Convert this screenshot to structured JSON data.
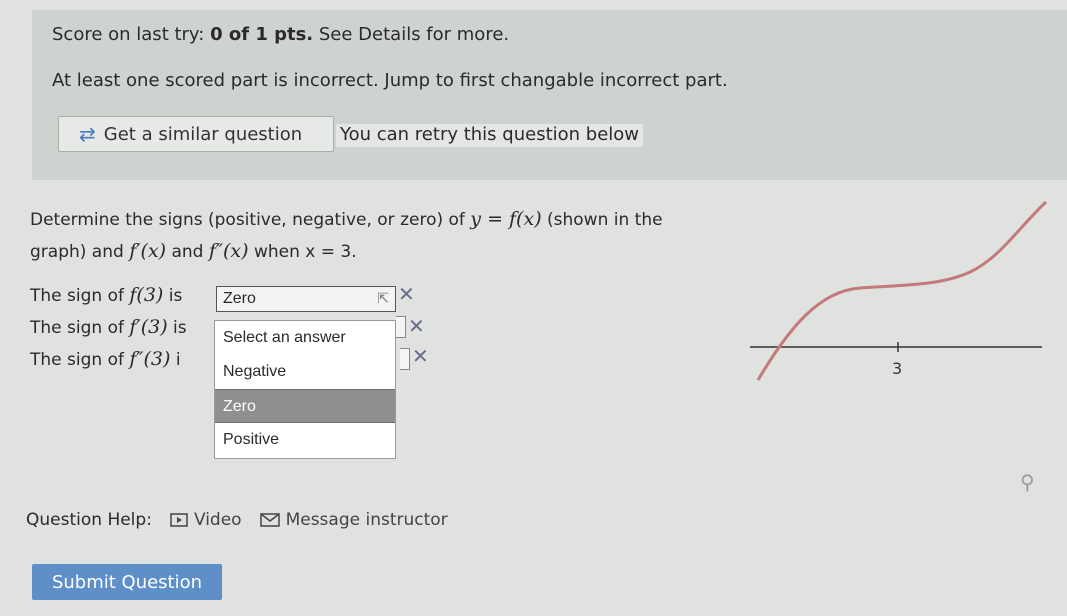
{
  "score": {
    "prefix": "Score on last try: ",
    "value": "0 of 1 pts.",
    "suffix": " See Details for more."
  },
  "notice": "At least one scored part is incorrect. Jump to first changable incorrect part.",
  "similar_button": {
    "icon": "refresh-icon",
    "label": "Get a similar question"
  },
  "retry_text": "You can retry this question below",
  "question": {
    "line1_pre": "Determine the signs (positive, negative, or zero) of ",
    "line1_math": "y = f(x)",
    "line1_post": " (shown in the",
    "line2_pre": "graph) and ",
    "fp": "f′(x)",
    "and": " and ",
    "fpp": "f″(x)",
    "line2_post": " when x = 3."
  },
  "rows": [
    {
      "prefix": "The sign of ",
      "math": "f(3)",
      "suffix": " is",
      "value": "Zero"
    },
    {
      "prefix": "The sign of ",
      "math": "f′(3)",
      "suffix": " is",
      "value": ""
    },
    {
      "prefix": "The sign of ",
      "math": "f″(3)",
      "suffix": " i",
      "value": ""
    }
  ],
  "dropdown": {
    "options": [
      "Select an answer",
      "Negative",
      "Zero",
      "Positive"
    ],
    "highlighted": "Zero"
  },
  "graph": {
    "tick_label": "3",
    "curve_color": "#c47a7a",
    "axis_color": "#333333"
  },
  "help": {
    "label": "Question Help:",
    "video": "Video",
    "message": "Message instructor"
  },
  "submit_label": "Submit Question",
  "colors": {
    "accent": "#5e8fc8",
    "link": "#4a7cc4"
  }
}
